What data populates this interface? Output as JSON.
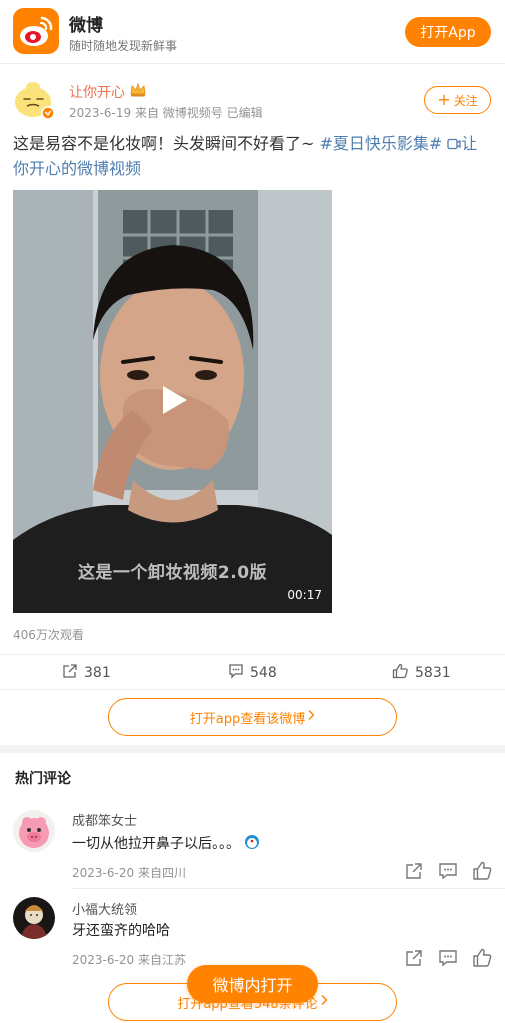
{
  "banner": {
    "app_name": "微博",
    "slogan": "随时随地发现新鲜事",
    "open_app": "打开App"
  },
  "post": {
    "author": "让你开心",
    "date": "2023-6-19",
    "source": "来自 微博视频号",
    "edited": "已编辑",
    "follow": "关注",
    "text_main": "这是易容不是化妆啊！头发瞬间不好看了~ ",
    "topic": "#夏日快乐影集#",
    "video_link": "让你开心的微博视频",
    "video": {
      "caption": "这是一个卸妆视频2.0版",
      "duration": "00:17"
    },
    "views": "406万次观看",
    "reposts": "381",
    "comments": "548",
    "likes": "5831",
    "view_in_app": "打开app查看该微博"
  },
  "hot_comments": {
    "title": "热门评论",
    "items": [
      {
        "name": "成都笨女士",
        "text": "一切从他拉开鼻子以后。。。",
        "date": "2023-6-20",
        "location": "来自四川"
      },
      {
        "name": "小福大统领",
        "text": "牙还蛮齐的哈哈",
        "date": "2023-6-20",
        "location": "来自江苏"
      }
    ],
    "view_all": "打开app查看548条评论"
  },
  "float_button": "微博内打开",
  "colors": {
    "accent": "#ff8200",
    "link": "#507daf",
    "author": "#eb7350"
  }
}
